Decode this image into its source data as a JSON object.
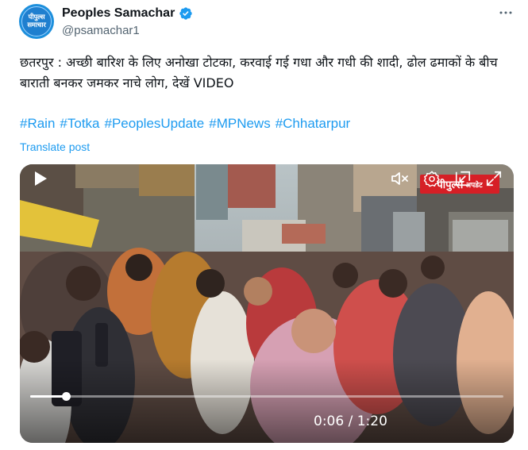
{
  "author": {
    "display_name": "Peoples Samachar",
    "handle": "@psamachar1",
    "avatar_text_line1": "पीपुल्स",
    "avatar_text_line2": "समाचार",
    "verified_icon": "verified-badge-icon",
    "brand_color": "#1d8fdc"
  },
  "menu": {
    "icon": "more-options-icon",
    "glyph": "•••"
  },
  "post": {
    "text": "छतरपुर : अच्छी बारिश के लिए अनोखा टोटका, करवाई गई गधा और गधी की शादी, ढोल ढमाकों के बीच बाराती बनकर जमकर नाचे लोग, देखें VIDEO",
    "hashtags": [
      "#Rain",
      "#Totka",
      "#PeoplesUpdate",
      "#MPNews",
      "#Chhatarpur"
    ],
    "translate_label": "Translate post",
    "link_color": "#1d9bf0"
  },
  "video": {
    "watermark_main": "पीपुल्स",
    "watermark_sub": "अपडेट",
    "watermark_color": "#d61f26",
    "current_time": "0:06",
    "duration": "1:20",
    "time_display": "0:06 / 1:20",
    "progress": 0.075,
    "icons": [
      "play-icon",
      "mute-icon",
      "settings-icon",
      "exit-fullscreen-icon",
      "expand-icon"
    ]
  }
}
